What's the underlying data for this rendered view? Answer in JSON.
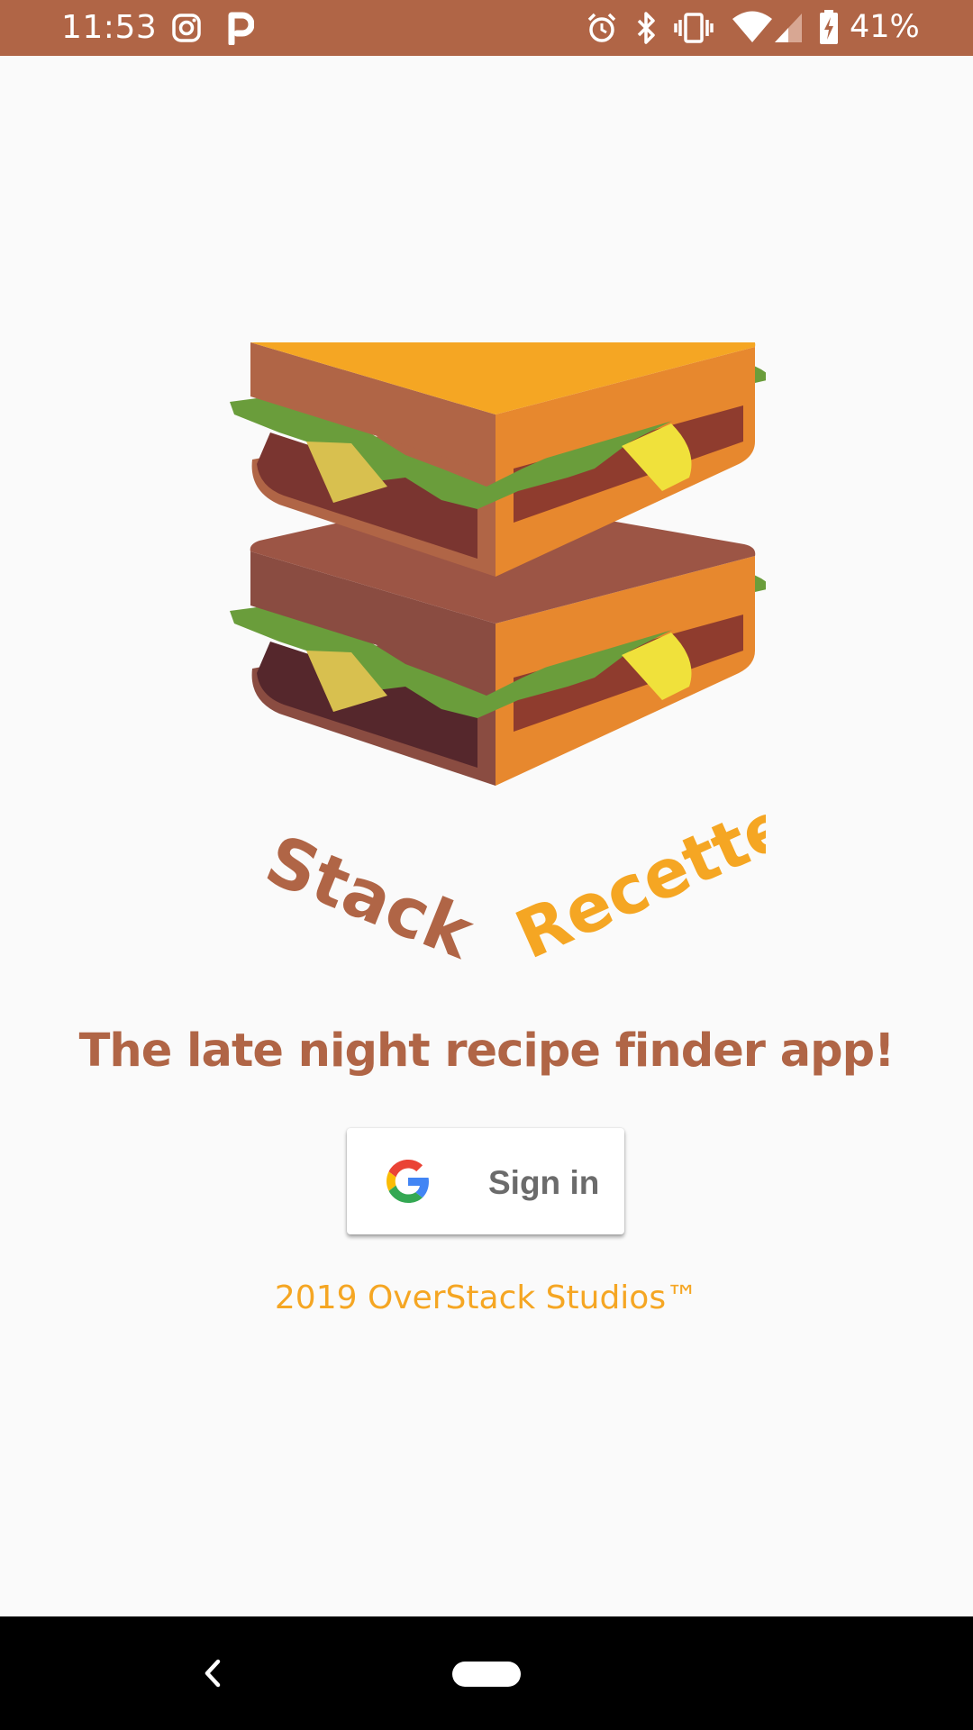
{
  "status_bar": {
    "time": "11:53",
    "battery": "41%",
    "icons": [
      "instagram-icon",
      "pocket-icon",
      "alarm-icon",
      "bluetooth-icon",
      "vibrate-icon",
      "wifi-icon",
      "signal-icon",
      "battery-charging-icon"
    ],
    "background": "#b06546"
  },
  "logo": {
    "word1": "Stack",
    "word2": "Recette",
    "colors": {
      "brown": "#b06546",
      "orange": "#f5a623"
    }
  },
  "tagline": "The late night recipe finder app!",
  "signin_button": {
    "label": "Sign in",
    "icon": "google-icon"
  },
  "copyright": "2019 OverStack Studios™",
  "nav_bar": {
    "icons": [
      "back-icon",
      "home-pill-icon"
    ]
  }
}
